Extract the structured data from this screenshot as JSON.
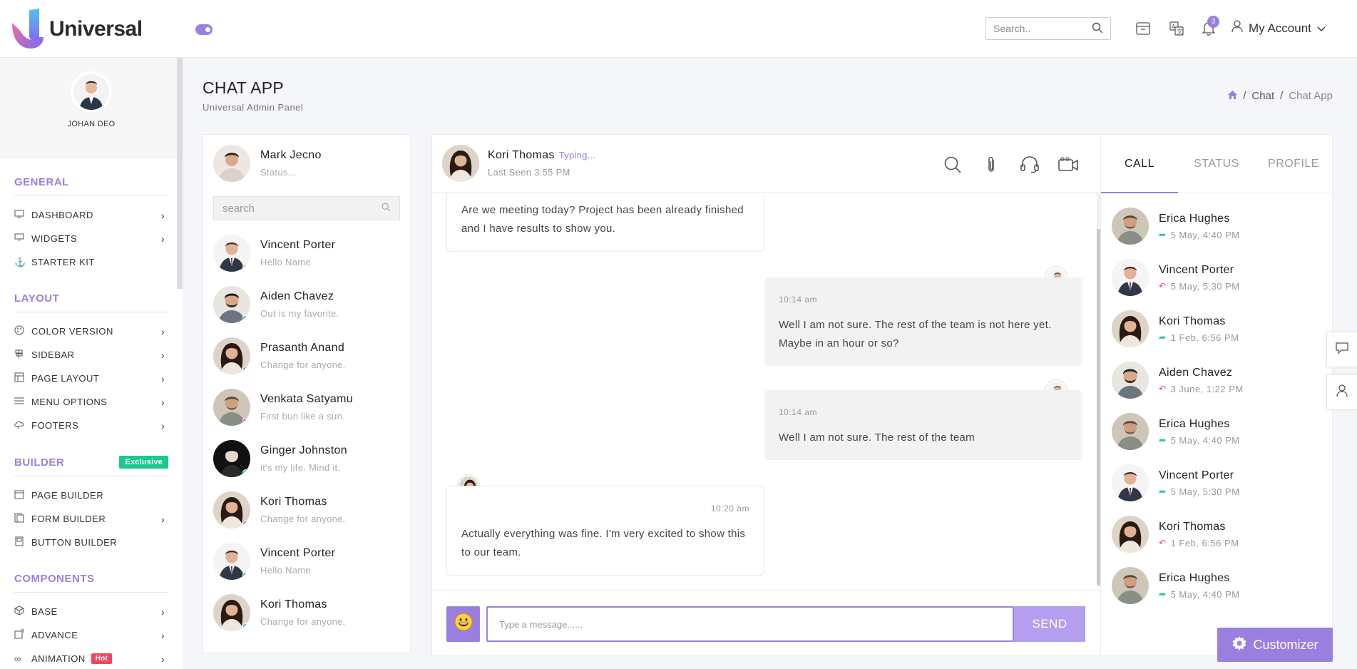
{
  "header": {
    "brand": "Universal",
    "search_placeholder": "Search..",
    "notification_count": "3",
    "account_label": "My Account"
  },
  "sidebar": {
    "profile_name": "JOHAN DEO",
    "sections": [
      {
        "title": "GENERAL",
        "items": [
          {
            "label": "DASHBOARD",
            "icon": "monitor-icon",
            "chevron": true
          },
          {
            "label": "WIDGETS",
            "icon": "desktop-icon",
            "chevron": true
          },
          {
            "label": "STARTER KIT",
            "icon": "anchor-icon",
            "chevron": false
          }
        ]
      },
      {
        "title": "LAYOUT",
        "items": [
          {
            "label": "COLOR VERSION",
            "icon": "palette-icon",
            "chevron": true
          },
          {
            "label": "SIDEBAR",
            "icon": "signpost-icon",
            "chevron": true
          },
          {
            "label": "PAGE LAYOUT",
            "icon": "layout-icon",
            "chevron": true
          },
          {
            "label": "MENU OPTIONS",
            "icon": "menu-icon",
            "chevron": true
          },
          {
            "label": "FOOTERS",
            "icon": "cloud-icon",
            "chevron": true
          }
        ]
      },
      {
        "title": "BUILDER",
        "badge": "Exclusive",
        "items": [
          {
            "label": "PAGE BUILDER",
            "icon": "calendar-icon",
            "chevron": false
          },
          {
            "label": "FORM BUILDER",
            "icon": "form-icon",
            "chevron": true
          },
          {
            "label": "BUTTON BUILDER",
            "icon": "button-icon",
            "chevron": false
          }
        ]
      },
      {
        "title": "COMPONENTS",
        "items": [
          {
            "label": "BASE",
            "icon": "box-icon",
            "chevron": true
          },
          {
            "label": "ADVANCE",
            "icon": "advance-icon",
            "chevron": true
          },
          {
            "label": "ANIMATION",
            "icon": "infinity-icon",
            "chevron": true,
            "badge": "Hot"
          }
        ]
      }
    ]
  },
  "page": {
    "title": "CHAT APP",
    "subtitle": "Universal Admin Panel",
    "breadcrumb": [
      "Chat",
      "Chat App"
    ]
  },
  "chat_list": {
    "me": {
      "name": "Mark Jecno",
      "status": "Status..."
    },
    "search_placeholder": "search",
    "contacts": [
      {
        "name": "Vincent Porter",
        "msg": "Hello Name",
        "status_color": "#ffc107",
        "avatar": "man-tie"
      },
      {
        "name": "Aiden Chavez",
        "msg": "Out is my favorite.",
        "status_color": "#1bc88a",
        "avatar": "man-beard"
      },
      {
        "name": "Prasanth Anand",
        "msg": "Change for anyone.",
        "status_color": "#1bc88a",
        "avatar": "woman-dark"
      },
      {
        "name": "Venkata Satyamu",
        "msg": "First bun like a sun.",
        "status_color": "#f0445c",
        "avatar": "man-casual"
      },
      {
        "name": "Ginger Johnston",
        "msg": "it's my life. Mind it.",
        "status_color": "#1bc88a",
        "avatar": "man-dark"
      },
      {
        "name": "Kori Thomas",
        "msg": "Change for anyone.",
        "status_color": "#f0445c",
        "avatar": "woman-dark"
      },
      {
        "name": "Vincent Porter",
        "msg": "Hello Name",
        "status_color": "#1bc88a",
        "avatar": "man-tie"
      },
      {
        "name": "Kori Thomas",
        "msg": "Change for anyone.",
        "status_color": "#1bc88a",
        "avatar": "woman-dark"
      }
    ]
  },
  "chat": {
    "contact_name": "Kori Thomas",
    "typing": "Typing...",
    "last_seen": "Last Seen 3:55 PM",
    "messages": [
      {
        "side": "left",
        "text": "Are we meeting today? Project has been already finished and I have results to show you."
      },
      {
        "side": "right",
        "time": "10:14 am",
        "text": "Well I am not sure. The rest of the team is not here yet. Maybe in an hour or so?"
      },
      {
        "side": "right",
        "time": "10:14 am",
        "text": "Well I am not sure. The rest of the team"
      },
      {
        "side": "left",
        "time": "10:20 am",
        "text": "Actually everything was fine. I'm very excited to show this to our team."
      }
    ],
    "input_placeholder": "Type a message......",
    "send_label": "SEND"
  },
  "right_panel": {
    "tabs": [
      "CALL",
      "STATUS",
      "PROFILE"
    ],
    "calls": [
      {
        "name": "Erica Hughes",
        "time": "5 May, 4:40 PM",
        "dir": "in",
        "avatar": "man-casual"
      },
      {
        "name": "Vincent Porter",
        "time": "5 May, 5:30 PM",
        "dir": "out",
        "avatar": "man-tie"
      },
      {
        "name": "Kori Thomas",
        "time": "1 Feb, 6:56 PM",
        "dir": "in",
        "avatar": "woman-dark"
      },
      {
        "name": "Aiden Chavez",
        "time": "3 June, 1:22 PM",
        "dir": "out",
        "avatar": "man-beard"
      },
      {
        "name": "Erica Hughes",
        "time": "5 May, 4:40 PM",
        "dir": "in",
        "avatar": "man-casual"
      },
      {
        "name": "Vincent Porter",
        "time": "5 May, 5:30 PM",
        "dir": "in",
        "avatar": "man-tie"
      },
      {
        "name": "Kori Thomas",
        "time": "1 Feb, 6:56 PM",
        "dir": "out",
        "avatar": "woman-dark"
      },
      {
        "name": "Erica Hughes",
        "time": "5 May, 4:40 PM",
        "dir": "in",
        "avatar": "man-casual"
      }
    ]
  },
  "customizer_label": "Customizer",
  "colors": {
    "accent": "#9b7fe0",
    "online": "#1bc88a",
    "busy": "#f0445c",
    "away": "#ffc107"
  }
}
